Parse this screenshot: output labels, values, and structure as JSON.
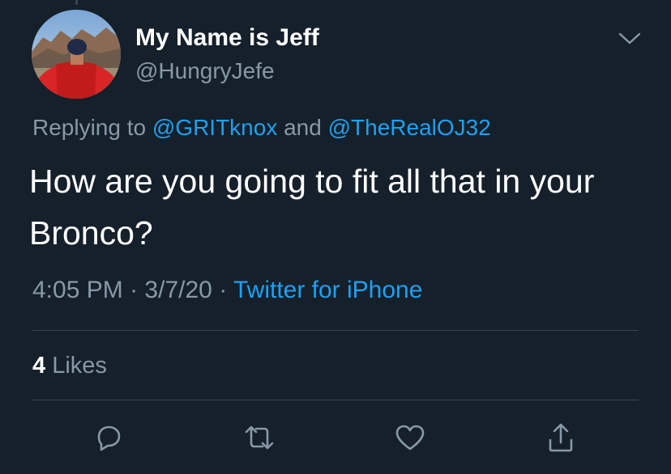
{
  "user": {
    "display_name": "My Name is Jeff",
    "handle": "@HungryJefe"
  },
  "reply": {
    "prefix": "Replying to",
    "mention_1": "@GRITknox",
    "conjunction": "and",
    "mention_2": "@TheRealOJ32"
  },
  "tweet": {
    "text": "How are you going to fit all that in your Bronco?"
  },
  "meta": {
    "time": "4:05 PM",
    "separator": "·",
    "date": "3/7/20",
    "source": "Twitter for iPhone"
  },
  "stats": {
    "likes_count": "4",
    "likes_label": "Likes"
  },
  "actions": [
    {
      "name": "reply-icon"
    },
    {
      "name": "retweet-icon"
    },
    {
      "name": "like-icon"
    },
    {
      "name": "share-icon"
    }
  ],
  "colors": {
    "background": "#15202b",
    "text_primary": "#ffffff",
    "text_secondary": "#8899a6",
    "accent": "#1da1f2",
    "divider": "#38444d"
  }
}
